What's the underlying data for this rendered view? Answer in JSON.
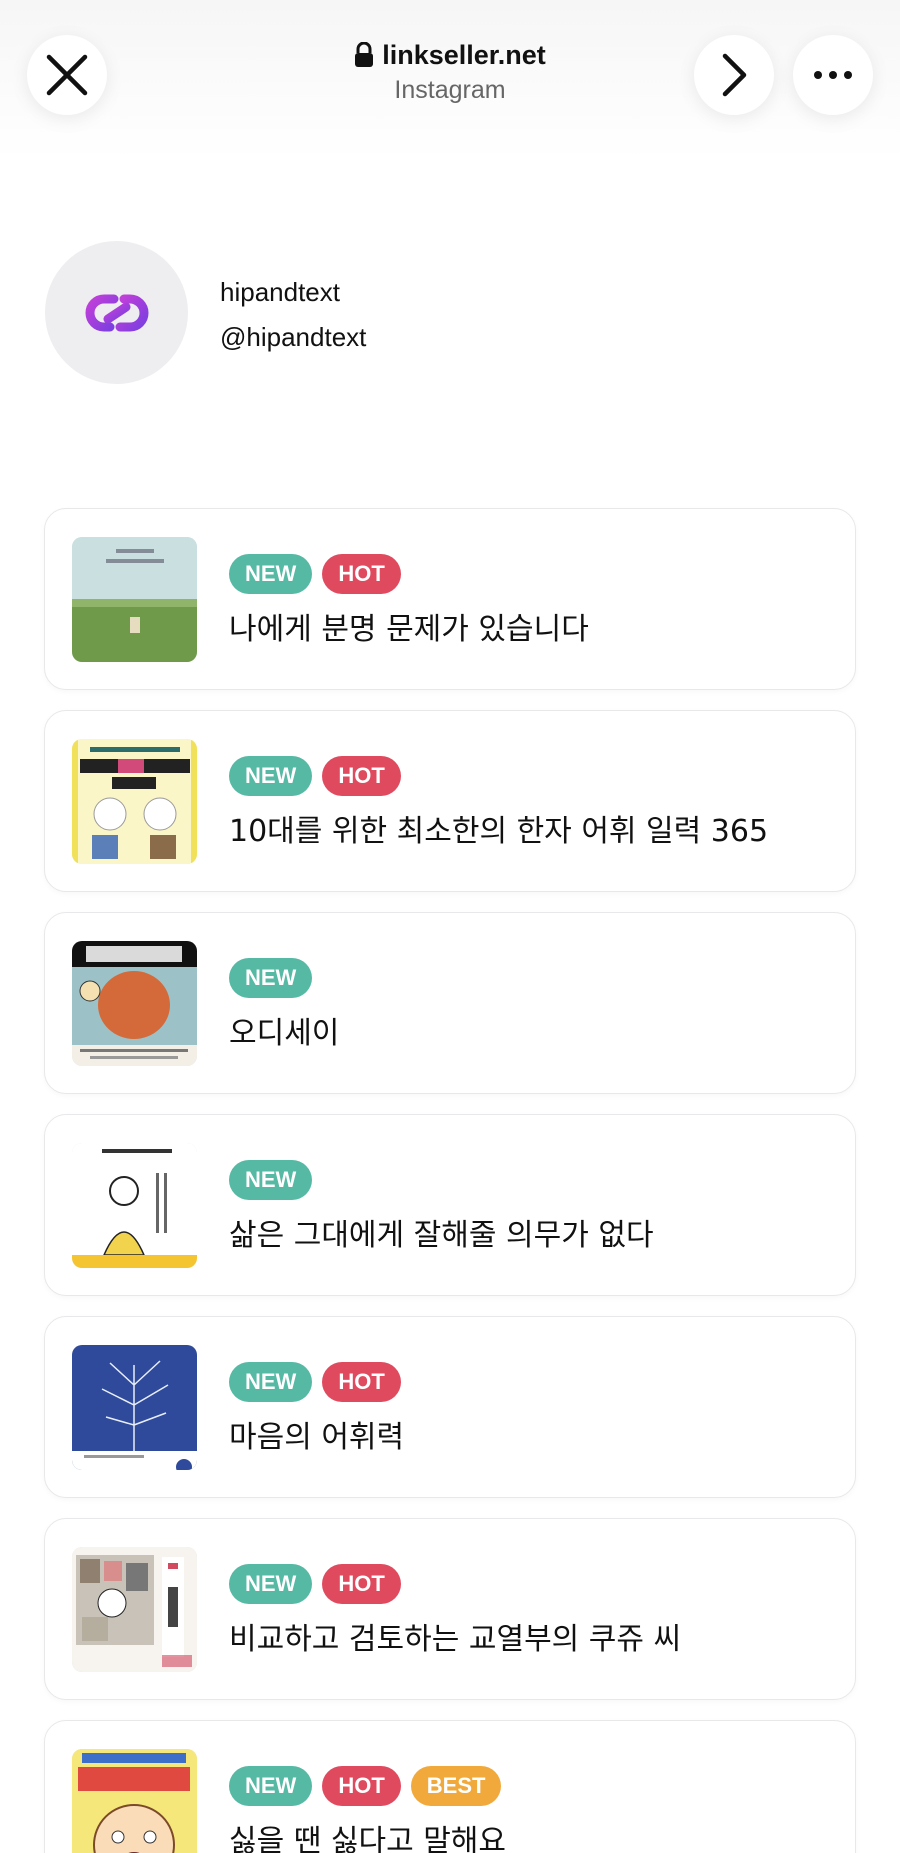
{
  "browser": {
    "url": "linkseller.net",
    "source": "Instagram",
    "close_icon": "close-icon",
    "forward_icon": "chevron-right-icon",
    "more_icon": "more-icon",
    "lock_icon": "lock-icon"
  },
  "profile": {
    "name": "hipandtext",
    "handle": "@hipandtext",
    "logo_icon": "link-logo-icon"
  },
  "colors": {
    "new": "#55b9a4",
    "hot": "#e04a5f",
    "best": "#f2a93b",
    "logo": "#9b3fd6"
  },
  "items": [
    {
      "badges": [
        "NEW",
        "HOT"
      ],
      "title": "나에게 분명 문제가 있습니다"
    },
    {
      "badges": [
        "NEW",
        "HOT"
      ],
      "title": "10대를 위한 최소한의 한자 어휘 일력 365"
    },
    {
      "badges": [
        "NEW"
      ],
      "title": "오디세이"
    },
    {
      "badges": [
        "NEW"
      ],
      "title": "삶은 그대에게 잘해줄 의무가 없다"
    },
    {
      "badges": [
        "NEW",
        "HOT"
      ],
      "title": "마음의 어휘력"
    },
    {
      "badges": [
        "NEW",
        "HOT"
      ],
      "title": "비교하고 검토하는 교열부의 쿠쥬 씨"
    },
    {
      "badges": [
        "NEW",
        "HOT",
        "BEST"
      ],
      "title": "싫을 땐 싫다고 말해요"
    }
  ]
}
